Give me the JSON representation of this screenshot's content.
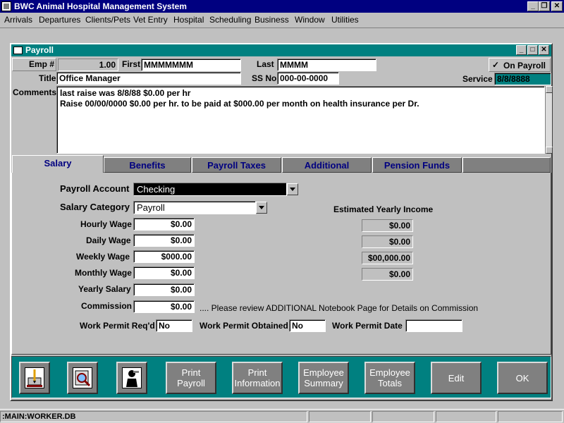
{
  "app": {
    "title": "BWC Animal Hospital Management System",
    "window_buttons": [
      "_",
      "❐",
      "✕"
    ]
  },
  "menu": [
    "Arrivals",
    "Departures",
    "Clients/Pets",
    "Vet Entry",
    "Hospital",
    "Scheduling",
    "Business",
    "Window",
    "Utilities"
  ],
  "child": {
    "title": "Payroll",
    "window_buttons": [
      "_",
      "□",
      "✕"
    ]
  },
  "header": {
    "emp_label": "Emp #",
    "emp_value": "1.00",
    "first_label": "First",
    "first_value": "MMMMMMM",
    "last_label": "Last",
    "last_value": "MMMM",
    "on_payroll_label": "On Payroll",
    "on_payroll_mark": "✓",
    "title_label": "Title",
    "title_value": "Office Manager",
    "ssno_label": "SS No",
    "ssno_value": "000-00-0000",
    "service_label": "Service",
    "service_value": "8/8/8888",
    "comments_label": "Comments",
    "comments_lines": [
      "last raise was 8/8/88 $0.00 per hr",
      "Raise 00/00/0000 $0.00 per hr. to be paid at $000.00 per month on health insurance per Dr."
    ]
  },
  "tabs": [
    "Salary",
    "Benefits",
    "Payroll Taxes",
    "Additional",
    "Pension Funds"
  ],
  "salary": {
    "payroll_account_label": "Payroll Account",
    "payroll_account_value": "Checking",
    "salary_category_label": "Salary Category",
    "salary_category_value": "Payroll",
    "hourly_wage_label": "Hourly Wage",
    "hourly_wage_value": "$0.00",
    "daily_wage_label": "Daily Wage",
    "daily_wage_value": "$0.00",
    "weekly_wage_label": "Weekly Wage",
    "weekly_wage_value": "$000.00",
    "monthly_wage_label": "Monthly Wage",
    "monthly_wage_value": "$0.00",
    "yearly_salary_label": "Yearly Salary",
    "yearly_salary_value": "$0.00",
    "commission_label": "Commission",
    "commission_value": "$0.00",
    "commission_note": ".... Please review ADDITIONAL Notebook Page for Details on Commission",
    "estimated_label": "Estimated Yearly Income",
    "estimated_values": [
      "$0.00",
      "$0.00",
      "$00,000.00",
      "$0.00"
    ],
    "work_permit_reqd_label": "Work Permit Req'd",
    "work_permit_reqd_value": "No",
    "work_permit_obtained_label": "Work Permit Obtained",
    "work_permit_obtained_value": "No",
    "work_permit_date_label": "Work Permit Date",
    "work_permit_date_value": ""
  },
  "toolbar": {
    "buttons": [
      "Print\nPayroll",
      "Print\nInformation",
      "Employee\nSummary",
      "Employee\nTotals",
      "Edit",
      "OK"
    ]
  },
  "status": {
    "path": ":MAIN:WORKER.DB"
  }
}
